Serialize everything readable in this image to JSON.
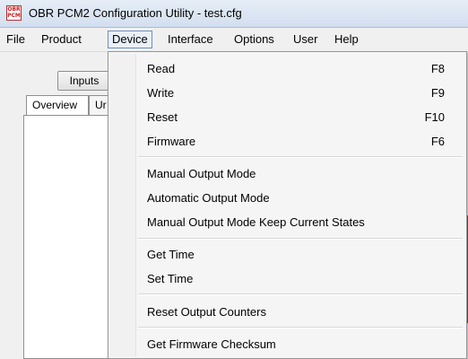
{
  "window": {
    "title": "OBR PCM2 Configuration Utility - test.cfg",
    "icon_text_top": "OBR",
    "icon_text_bottom": "PCM"
  },
  "menubar": {
    "items": [
      "File",
      "Product",
      "Device",
      "Interface",
      "Options",
      "User",
      "Help"
    ],
    "active": "Device"
  },
  "background": {
    "inputs_button": "Inputs",
    "tabs": [
      "Overview",
      "Ur"
    ]
  },
  "device_menu": {
    "groups": [
      [
        {
          "label": "Read",
          "shortcut": "F8"
        },
        {
          "label": "Write",
          "shortcut": "F9"
        },
        {
          "label": "Reset",
          "shortcut": "F10"
        },
        {
          "label": "Firmware",
          "shortcut": "F6"
        }
      ],
      [
        {
          "label": "Manual Output Mode",
          "shortcut": ""
        },
        {
          "label": "Automatic Output Mode",
          "shortcut": ""
        },
        {
          "label": "Manual Output Mode Keep Current States",
          "shortcut": ""
        }
      ],
      [
        {
          "label": "Get Time",
          "shortcut": ""
        },
        {
          "label": "Set Time",
          "shortcut": ""
        }
      ],
      [
        {
          "label": "Reset Output Counters",
          "shortcut": ""
        }
      ],
      [
        {
          "label": "Get Firmware Checksum",
          "shortcut": ""
        }
      ]
    ]
  }
}
